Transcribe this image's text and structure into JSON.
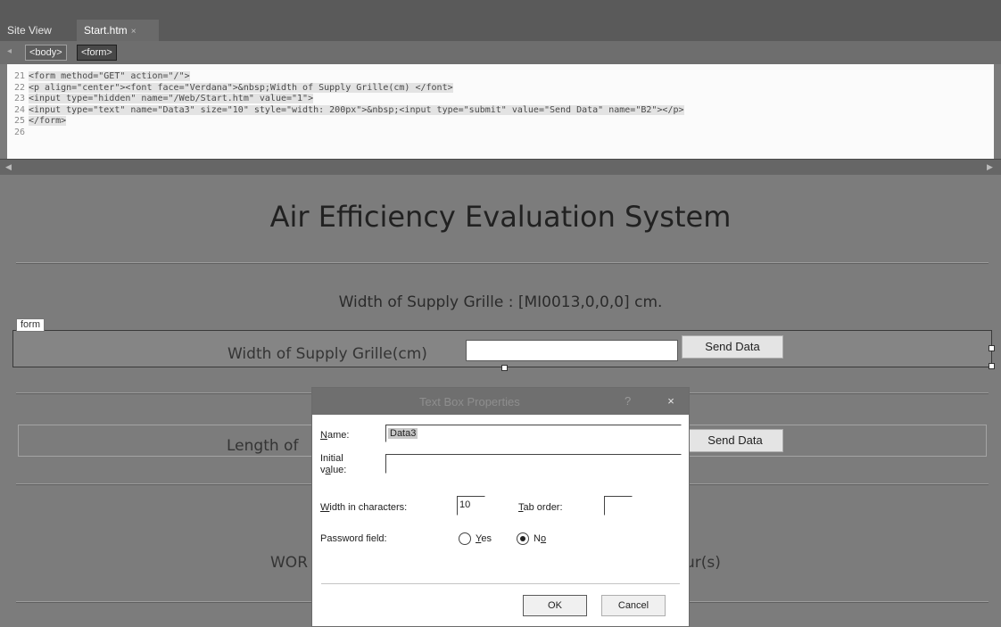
{
  "tabs": [
    {
      "label": "Site View"
    },
    {
      "label": "Start.htm",
      "close": "×"
    }
  ],
  "tag_selector": [
    "<body>",
    "<form>"
  ],
  "code": {
    "line_numbers": [
      "21",
      "22",
      "23",
      "24",
      "25",
      "26"
    ],
    "lines": [
      "<form method=\"GET\" action=\"/\">",
      "<p align=\"center\"><font face=\"Verdana\">&nbsp;Width of Supply Grille(cm) </font>",
      "<input type=\"hidden\" name=\"/Web/Start.htm\" value=\"1\">",
      "<input type=\"text\" name=\"Data3\" size=\"10\" style=\"width: 200px\">&nbsp;<input type=\"submit\" value=\"Send Data\" name=\"B2\"></p>",
      "</form>",
      ""
    ]
  },
  "design": {
    "title": "Air Efficiency Evaluation System",
    "info_line": "Width of Supply Grille : [MI0013,0,0,0] cm.",
    "form_tag": "form",
    "row1_label": "Width of Supply Grille(cm)",
    "row1_button": "Send Data",
    "row2_label": "Length of",
    "row2_button": "Send Data",
    "row3_left": "WOR",
    "row3_right": "ur(s)"
  },
  "dialog": {
    "title": "Text Box Properties",
    "help": "?",
    "close": "×",
    "name_label_underlined": "N",
    "name_label_rest": "ame:",
    "name_value": "Data3",
    "initial_value_label_line1": "Initial",
    "initial_value_label_pre": "v",
    "initial_value_label_u": "a",
    "initial_value_label_post": "lue:",
    "initial_value": "",
    "width_label_u": "W",
    "width_label_rest": "idth in characters:",
    "width_value": "10",
    "tab_order_label_u": "T",
    "tab_order_label_rest": "ab order:",
    "tab_order_value": "",
    "password_label": "Password field:",
    "yes_label_u": "Y",
    "yes_label_rest": "es",
    "no_label_pre": "N",
    "no_label_u": "o",
    "password_selected": "No",
    "ok_label": "OK",
    "cancel_label": "Cancel"
  }
}
